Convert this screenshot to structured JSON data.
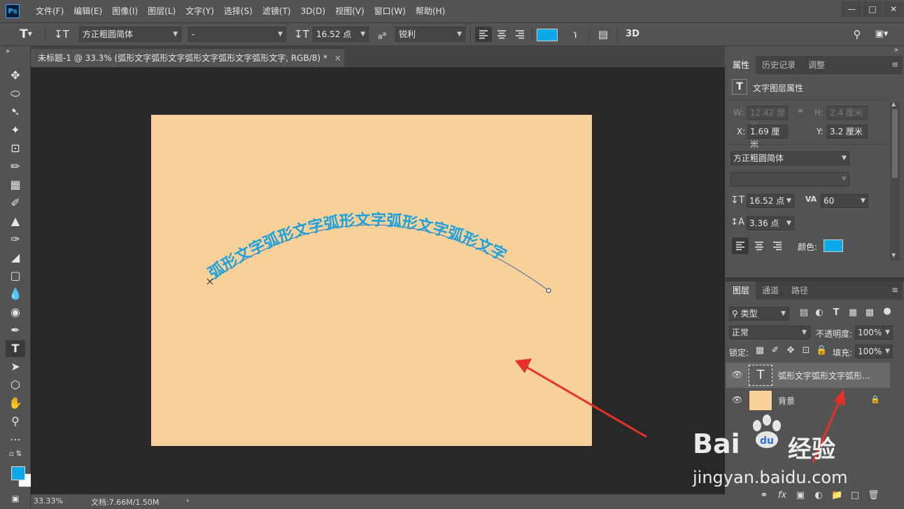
{
  "menubar": {
    "logo": "Ps",
    "items": [
      "文件(F)",
      "编辑(E)",
      "图像(I)",
      "图层(L)",
      "文字(Y)",
      "选择(S)",
      "滤镜(T)",
      "3D(D)",
      "视图(V)",
      "窗口(W)",
      "帮助(H)"
    ],
    "window_controls": [
      "minimize-icon",
      "restore-icon",
      "close-icon"
    ]
  },
  "options": {
    "font_family": "方正粗圆简体",
    "font_style": "-",
    "font_size": "16.52 点",
    "aa_label": "a",
    "antialias": "锐利",
    "text_color": "#0aa9e8",
    "three_d": "3D"
  },
  "document": {
    "tab_title": "未标题-1 @ 33.3% (弧形文字弧形文字弧形文字弧形文字弧形文字, RGB/8) *",
    "arc_text": "弧形文字弧形文字弧形文字弧形文字弧形文字",
    "canvas_color": "#f8d19a",
    "text_color": "#1aa2de"
  },
  "status": {
    "zoom": "33.33%",
    "doc_size": "文档:7.66M/1.50M"
  },
  "properties": {
    "tabs": [
      "属性",
      "历史记录",
      "调整"
    ],
    "header_icon": "T",
    "header": "文字图层属性",
    "w_label": "W:",
    "w_value": "12.42 厘米",
    "h_label": "H:",
    "h_value": "2.4 厘米",
    "x_label": "X:",
    "x_value": "1.69 厘米",
    "y_label": "Y:",
    "y_value": "3.2 厘米",
    "font_family": "方正粗圆简体",
    "font_size": "16.52 点",
    "tracking": "60",
    "leading": "3.36 点",
    "color_label": "颜色:",
    "color": "#0aa9e8"
  },
  "layers": {
    "tabs": [
      "图层",
      "通道",
      "路径"
    ],
    "filter": "类型",
    "blend_mode": "正常",
    "opacity_label": "不透明度:",
    "opacity": "100%",
    "lock_label": "锁定:",
    "fill_label": "填充:",
    "fill": "100%",
    "items": [
      {
        "name": "弧形文字弧形文字弧形...",
        "thumb": "T"
      },
      {
        "name": "背景",
        "thumb_color": "#f8d19a"
      }
    ]
  },
  "watermark": {
    "brand_a": "Bai",
    "brand_b": "经验",
    "url": "jingyan.baidu.com"
  }
}
